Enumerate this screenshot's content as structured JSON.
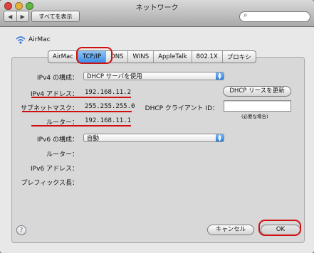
{
  "window": {
    "title": "ネットワーク"
  },
  "toolbar": {
    "back": "◀",
    "forward": "▶",
    "show_all": "すべてを表示",
    "search_placeholder": ""
  },
  "service": {
    "name": "AirMac"
  },
  "tabs": [
    "AirMac",
    "TCP/IP",
    "DNS",
    "WINS",
    "AppleTalk",
    "802.1X",
    "プロキシ"
  ],
  "selected_tab": "TCP/IP",
  "ipv4": {
    "config_label": "IPv4 の構成：",
    "config_value": "DHCP サーバを使用",
    "address_label": "IPv4 アドレス：",
    "address_value": "192.168.11.2",
    "subnet_label": "サブネットマスク：",
    "subnet_value": "255.255.255.0",
    "router_label": "ルーター：",
    "router_value": "192.168.11.1",
    "renew_button": "DHCP リースを更新",
    "client_id_label": "DHCP クライアント ID：",
    "client_id_value": "",
    "client_id_hint": "(必要な場合)"
  },
  "ipv6": {
    "config_label": "IPv6 の構成：",
    "config_value": "自動",
    "router_label": "ルーター：",
    "address_label": "IPv6 アドレス：",
    "prefix_label": "プレフィックス長："
  },
  "footer": {
    "help": "?",
    "cancel": "キャンセル",
    "ok": "OK"
  },
  "colors": {
    "highlight": "#d01010",
    "selected_tab": "#3a8ee8"
  }
}
